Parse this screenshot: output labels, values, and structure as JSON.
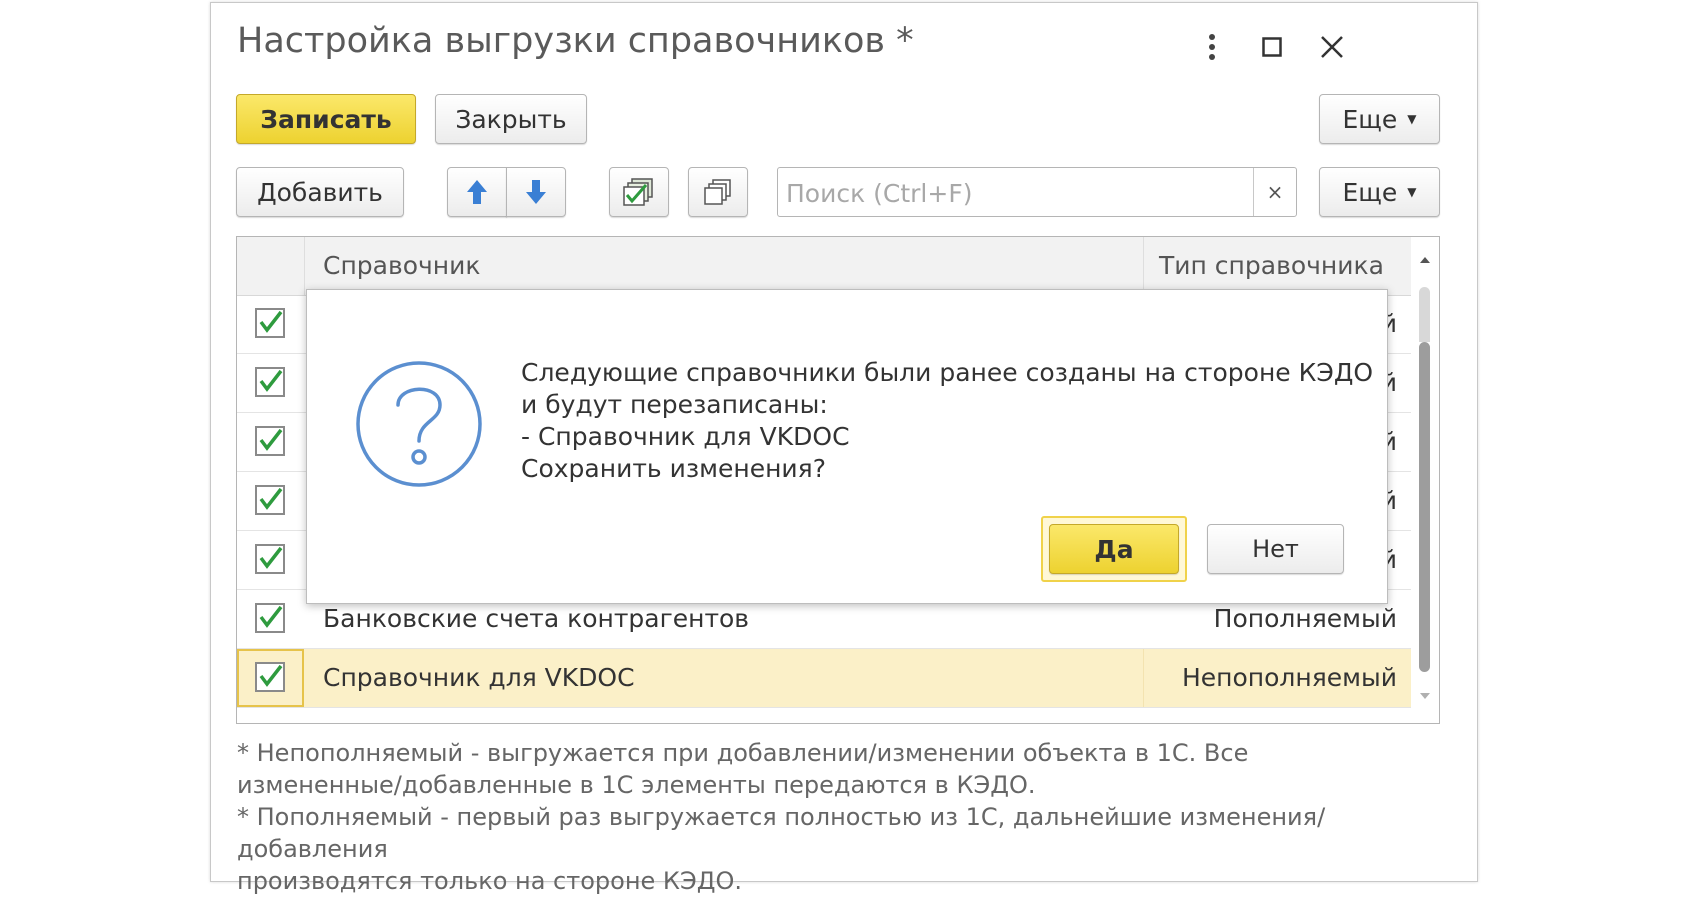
{
  "window": {
    "title": "Настройка выгрузки справочников *"
  },
  "toolbar1": {
    "save_label": "Записать",
    "close_label": "Закрыть",
    "more_label": "Еще"
  },
  "toolbar2": {
    "add_label": "Добавить",
    "more_label": "Еще",
    "search_placeholder": "Поиск (Ctrl+F)",
    "search_value": "",
    "clear_glyph": "×"
  },
  "table": {
    "columns": [
      "Справочник",
      "Тип справочника"
    ],
    "rows": [
      {
        "checked": true,
        "name": "",
        "type": "й"
      },
      {
        "checked": true,
        "name": "",
        "type": "й"
      },
      {
        "checked": true,
        "name": "",
        "type": "й"
      },
      {
        "checked": true,
        "name": "",
        "type": "й"
      },
      {
        "checked": true,
        "name": "",
        "type": "й"
      },
      {
        "checked": true,
        "name": "Банковские счета контрагентов",
        "type": "Пополняемый"
      },
      {
        "checked": true,
        "name": "Справочник для VKDOC",
        "type": "Непополняемый",
        "selected": true
      }
    ]
  },
  "footnotes": {
    "line1": "* Непополняемый - выгружается при добавлении/изменении объекта в 1С. Все",
    "line2": "измененные/добавленные в 1С элементы передаются в КЭДО.",
    "line3": "* Пополняемый - первый раз выгружается полностью из 1С, дальнейшие изменения/добавления",
    "line4": "производятся только на стороне КЭДО."
  },
  "dialog": {
    "line1": "Следующие справочники были ранее созданы на стороне КЭДО",
    "line2": "и будут перезаписаны:",
    "line3": "- Справочник для VKDOC",
    "line4": "Сохранить изменения?",
    "yes_label": "Да",
    "no_label": "Нет"
  },
  "colors": {
    "accent_yellow": "#f0d43a",
    "check_green": "#2e9b3e",
    "question_blue": "#5b8fd0",
    "arrow_blue": "#3a7fd4",
    "selected_row": "#fbf0c8"
  }
}
